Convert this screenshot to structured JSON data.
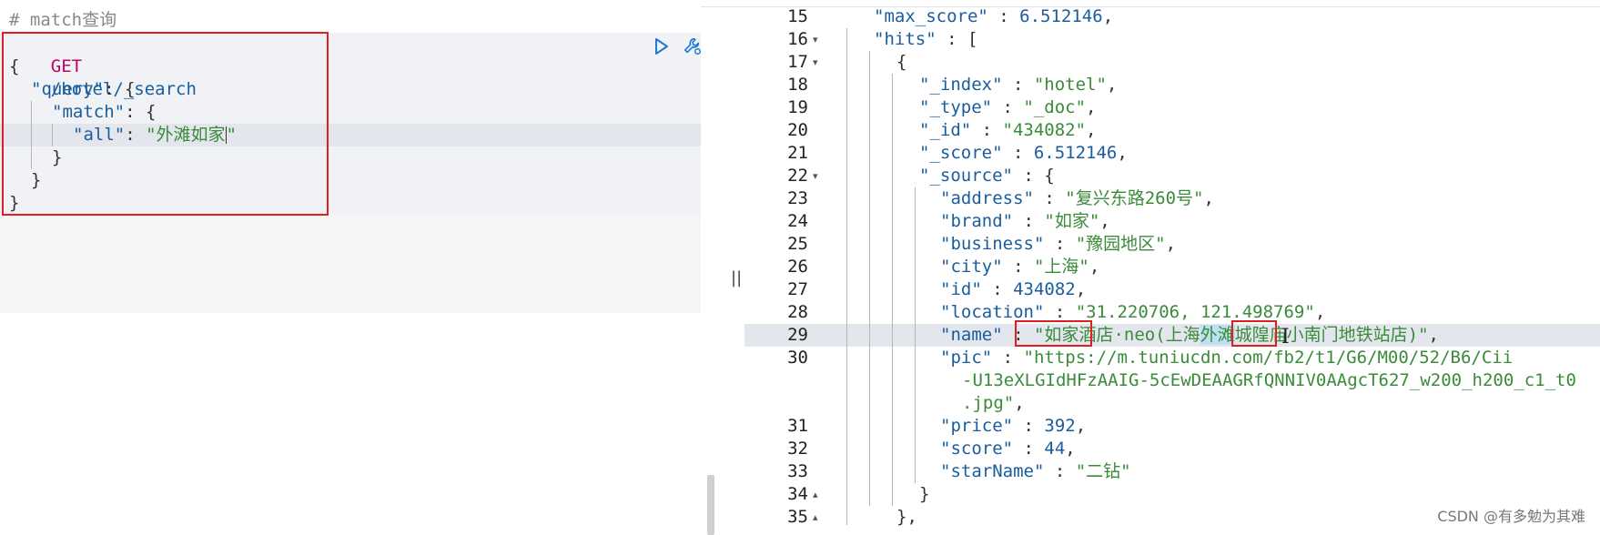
{
  "request": {
    "comment": "# match查询",
    "method": "GET",
    "path": "/hotel/_search",
    "lines": [
      {
        "t": "{"
      },
      {
        "k": "\"query\"",
        "t": ": {"
      },
      {
        "k": "\"match\"",
        "t": ": {"
      },
      {
        "k": "\"all\"",
        "t": ": ",
        "s": "\"外滩如家\""
      },
      {
        "t": "}"
      },
      {
        "t": "}"
      },
      {
        "t": "}"
      }
    ]
  },
  "icons": {
    "run": "play-icon",
    "settings": "wrench-icon",
    "divider": "||"
  },
  "response_lines": [
    {
      "n": "15",
      "f": "",
      "segs": [
        [
          "k",
          "\"max_score\""
        ],
        [
          "p",
          " : "
        ],
        [
          "n",
          "6.512146"
        ],
        [
          "p",
          ","
        ]
      ]
    },
    {
      "n": "16",
      "f": "▾",
      "segs": [
        [
          "k",
          "\"hits\""
        ],
        [
          "p",
          " : ["
        ]
      ]
    },
    {
      "n": "17",
      "f": "▾",
      "segs": [
        [
          "p",
          "{"
        ]
      ]
    },
    {
      "n": "18",
      "f": "",
      "segs": [
        [
          "k",
          "\"_index\""
        ],
        [
          "p",
          " : "
        ],
        [
          "s",
          "\"hotel\""
        ],
        [
          "p",
          ","
        ]
      ]
    },
    {
      "n": "19",
      "f": "",
      "segs": [
        [
          "k",
          "\"_type\""
        ],
        [
          "p",
          " : "
        ],
        [
          "s",
          "\"_doc\""
        ],
        [
          "p",
          ","
        ]
      ]
    },
    {
      "n": "20",
      "f": "",
      "segs": [
        [
          "k",
          "\"_id\""
        ],
        [
          "p",
          " : "
        ],
        [
          "s",
          "\"434082\""
        ],
        [
          "p",
          ","
        ]
      ]
    },
    {
      "n": "21",
      "f": "",
      "segs": [
        [
          "k",
          "\"_score\""
        ],
        [
          "p",
          " : "
        ],
        [
          "n",
          "6.512146"
        ],
        [
          "p",
          ","
        ]
      ]
    },
    {
      "n": "22",
      "f": "▾",
      "segs": [
        [
          "k",
          "\"_source\""
        ],
        [
          "p",
          " : {"
        ]
      ]
    },
    {
      "n": "23",
      "f": "",
      "segs": [
        [
          "k",
          "\"address\""
        ],
        [
          "p",
          " : "
        ],
        [
          "s",
          "\"复兴东路260号\""
        ],
        [
          "p",
          ","
        ]
      ]
    },
    {
      "n": "24",
      "f": "",
      "segs": [
        [
          "k",
          "\"brand\""
        ],
        [
          "p",
          " : "
        ],
        [
          "s",
          "\"如家\""
        ],
        [
          "p",
          ","
        ]
      ]
    },
    {
      "n": "25",
      "f": "",
      "segs": [
        [
          "k",
          "\"business\""
        ],
        [
          "p",
          " : "
        ],
        [
          "s",
          "\"豫园地区\""
        ],
        [
          "p",
          ","
        ]
      ]
    },
    {
      "n": "26",
      "f": "",
      "segs": [
        [
          "k",
          "\"city\""
        ],
        [
          "p",
          " : "
        ],
        [
          "s",
          "\"上海\""
        ],
        [
          "p",
          ","
        ]
      ]
    },
    {
      "n": "27",
      "f": "",
      "segs": [
        [
          "k",
          "\"id\""
        ],
        [
          "p",
          " : "
        ],
        [
          "n",
          "434082"
        ],
        [
          "p",
          ","
        ]
      ]
    },
    {
      "n": "28",
      "f": "",
      "segs": [
        [
          "k",
          "\"location\""
        ],
        [
          "p",
          " : "
        ],
        [
          "s",
          "\"31.220706, 121.498769\""
        ],
        [
          "p",
          ","
        ]
      ]
    },
    {
      "n": "29",
      "f": "",
      "segs": [
        [
          "k",
          "\"name\""
        ],
        [
          "p",
          " : "
        ],
        [
          "s",
          "\""
        ],
        [
          "sb",
          "如家"
        ],
        [
          "s",
          "酒店·neo(上海"
        ],
        [
          "sh",
          "外滩"
        ],
        [
          "s",
          "城隍庙小南门地铁站店)\""
        ],
        [
          "p",
          ","
        ]
      ]
    },
    {
      "n": "30",
      "f": "",
      "segs": [
        [
          "k",
          "\"pic\""
        ],
        [
          "p",
          " : "
        ],
        [
          "s",
          "\"https://m.tuniucdn.com/fb2/t1/G6/M00/52/B6/Cii"
        ]
      ]
    },
    {
      "n": "",
      "f": "",
      "segs": [
        [
          "s",
          "-U13eXLGIdHFzAAIG-5cEwDEAAGRfQNNIV0AAgcT627_w200_h200_c1_t0"
        ]
      ]
    },
    {
      "n": "",
      "f": "",
      "segs": [
        [
          "s",
          ".jpg\""
        ],
        [
          "p",
          ","
        ]
      ]
    },
    {
      "n": "31",
      "f": "",
      "segs": [
        [
          "k",
          "\"price\""
        ],
        [
          "p",
          " : "
        ],
        [
          "n",
          "392"
        ],
        [
          "p",
          ","
        ]
      ]
    },
    {
      "n": "32",
      "f": "",
      "segs": [
        [
          "k",
          "\"score\""
        ],
        [
          "p",
          " : "
        ],
        [
          "n",
          "44"
        ],
        [
          "p",
          ","
        ]
      ]
    },
    {
      "n": "33",
      "f": "",
      "segs": [
        [
          "k",
          "\"starName\""
        ],
        [
          "p",
          " : "
        ],
        [
          "s",
          "\"二钻\""
        ]
      ]
    },
    {
      "n": "34",
      "f": "▴",
      "segs": [
        [
          "p",
          "}"
        ]
      ]
    },
    {
      "n": "35",
      "f": "▴",
      "segs": [
        [
          "p",
          "},"
        ]
      ]
    }
  ],
  "watermark": "CSDN @有多勉为其难"
}
